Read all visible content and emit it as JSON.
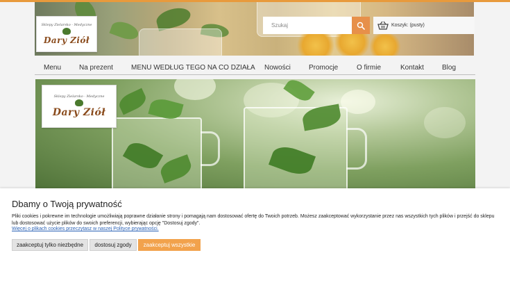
{
  "header": {
    "logo": {
      "subtitle": "Sklepy Zielarsko - Medyczne",
      "name": "Dary Ziół"
    },
    "search": {
      "placeholder": "Szukaj",
      "icon": "search-icon"
    },
    "cart": {
      "label": "Koszyk: (pusty)",
      "icon": "basket-icon"
    },
    "top_links": [
      "",
      ""
    ]
  },
  "nav": {
    "items": [
      {
        "label": "Menu"
      },
      {
        "label": "Na prezent"
      },
      {
        "label": "MENU WEDŁUG TEGO NA CO DZIAŁA"
      },
      {
        "label": "Nowości"
      },
      {
        "label": "Promocje"
      },
      {
        "label": "O firmie"
      },
      {
        "label": "Kontakt"
      },
      {
        "label": "Blog"
      }
    ]
  },
  "hero": {
    "logo": {
      "subtitle": "Sklepy Zielarsko - Medyczne",
      "name": "Dary Ziół"
    }
  },
  "cookie": {
    "title": "Dbamy o Twoją prywatność",
    "text": "Pliki cookies i pokrewne im technologie umożliwiają poprawne działanie strony i pomagają nam dostosować ofertę do Twoich potrzeb. Możesz zaakceptować wykorzystanie przez nas wszystkich tych plików i przejść do sklepu lub dostosować użycie plików do swoich preferencji, wybierając opcję \"Dostosuj zgody\".",
    "link": "Więcej o plikach cookies przeczytasz w naszej Polityce prywatności.",
    "buttons": {
      "necessary": "zaakceptuj tylko niezbędne",
      "customize": "dostosuj zgody",
      "accept_all": "zaakceptuj wszystkie"
    }
  },
  "colors": {
    "accent": "#e7904a",
    "button_accept": "#f2a24c",
    "link": "#2b62b5",
    "logo_brown": "#8a4b1c"
  }
}
